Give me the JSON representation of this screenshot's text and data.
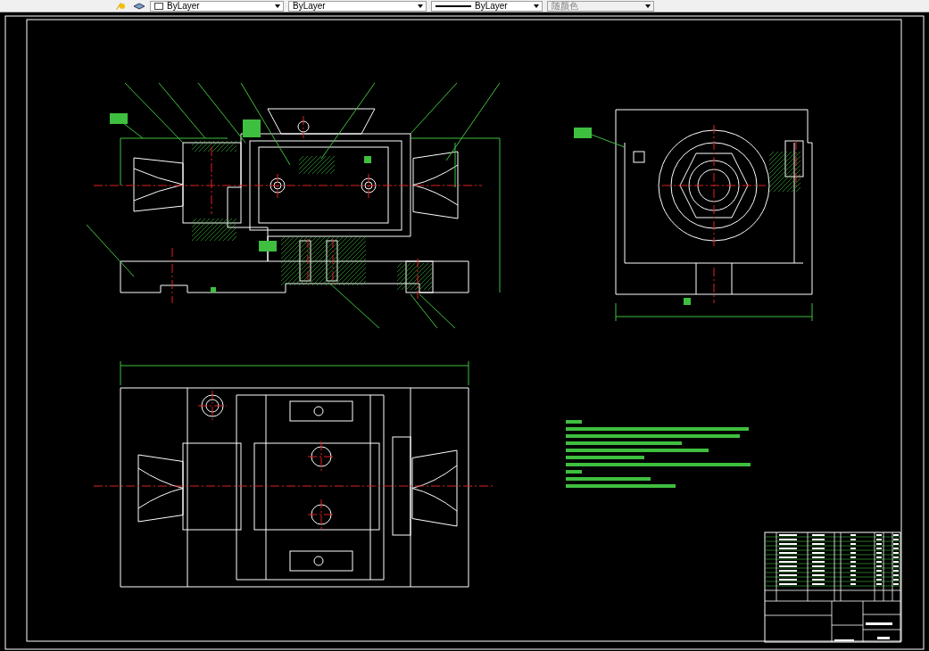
{
  "toolbar": {
    "dropdowns": [
      {
        "kind": "layer",
        "value": "ByLayer"
      },
      {
        "kind": "linetype",
        "value": "ByLayer"
      },
      {
        "kind": "lineweight",
        "value": "ByLayer"
      },
      {
        "kind": "plotstyle",
        "value": "随颜色"
      }
    ]
  }
}
